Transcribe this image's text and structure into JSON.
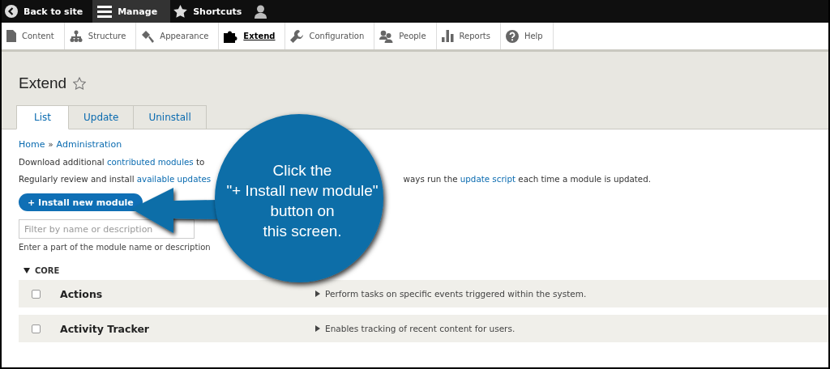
{
  "toolbar": {
    "items": [
      {
        "label": "Back to site",
        "selected": false
      },
      {
        "label": "Manage",
        "selected": true
      },
      {
        "label": "Shortcuts",
        "selected": false
      },
      {
        "selected": false
      }
    ]
  },
  "tray": {
    "items": [
      {
        "label": "Content",
        "selected": false
      },
      {
        "label": "Structure",
        "selected": false
      },
      {
        "label": "Appearance",
        "selected": false
      },
      {
        "label": "Extend",
        "selected": true
      },
      {
        "label": "Configuration",
        "selected": false
      },
      {
        "label": "People",
        "selected": false
      },
      {
        "label": "Reports",
        "selected": false
      },
      {
        "label": "Help",
        "selected": false
      }
    ]
  },
  "page": {
    "title": "Extend",
    "favorite": false
  },
  "tabs": [
    {
      "label": "List",
      "selected": true
    },
    {
      "label": "Update",
      "selected": false
    },
    {
      "label": "Uninstall",
      "selected": false
    }
  ],
  "breadcrumb": [
    "Home",
    "Administration"
  ],
  "breadcrumb_separator": "»",
  "intro": [
    {
      "kind": "text",
      "text": "Download additional"
    },
    {
      "kind": "link",
      "text": "contributed modules"
    },
    {
      "kind": "text",
      "text": "to"
    }
  ],
  "notice_left": [
    {
      "kind": "text",
      "text": "Regularly review and install"
    },
    {
      "kind": "link",
      "text": "available updates"
    }
  ],
  "notice_right": [
    {
      "kind": "text",
      "text": "ways run the"
    },
    {
      "kind": "link",
      "text": "update script"
    },
    {
      "kind": "text",
      "text": "each time a module is updated."
    }
  ],
  "install_button": "+ Install new module",
  "filter": {
    "placeholder": "Filter by name or description",
    "help": "Enter a part of the module name or description"
  },
  "group": {
    "label": "CORE",
    "expanded": true
  },
  "modules": [
    {
      "name": "Actions",
      "description": "Perform tasks on specific events triggered within the system.",
      "checked": false
    },
    {
      "name": "Activity Tracker",
      "description": "Enables tracking of recent content for users.",
      "checked": false
    }
  ],
  "callout": {
    "text": "Click the\n\"+ Install new module\"\nbutton on\nthis screen."
  }
}
